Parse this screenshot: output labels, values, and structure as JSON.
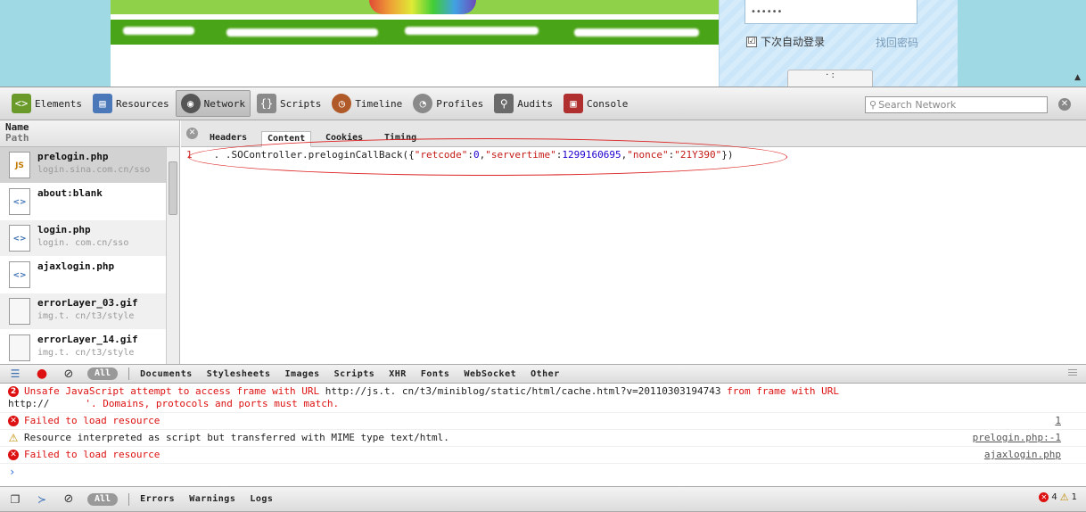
{
  "page": {
    "password_mask": "••••••",
    "remember_label": "下次自动登录",
    "remember_check": "☑",
    "find_password": "找回密码",
    "login_button": "· :",
    "scroll_up": "▲"
  },
  "toolbar": {
    "tools": [
      {
        "label": "Elements",
        "icon": "elements-icon",
        "color": "#6a9b2a"
      },
      {
        "label": "Resources",
        "icon": "resources-icon",
        "color": "#4a78b8"
      },
      {
        "label": "Network",
        "icon": "network-icon",
        "color": "#555555"
      },
      {
        "label": "Scripts",
        "icon": "scripts-icon",
        "color": "#8a8a8a"
      },
      {
        "label": "Timeline",
        "icon": "timeline-icon",
        "color": "#b05a2a"
      },
      {
        "label": "Profiles",
        "icon": "profiles-icon",
        "color": "#8a8a8a"
      },
      {
        "label": "Audits",
        "icon": "audits-icon",
        "color": "#6a6a6a"
      },
      {
        "label": "Console",
        "icon": "console-icon",
        "color": "#b03030"
      }
    ],
    "active": "Network",
    "search_placeholder": "Search Network",
    "close": "✕"
  },
  "resources": {
    "header_name": "Name",
    "header_path": "Path",
    "items": [
      {
        "name": "prelogin.php",
        "path": "login.sina.com.cn/sso",
        "type": "JS"
      },
      {
        "name": "about:blank",
        "path": "",
        "type": "<>"
      },
      {
        "name": "login.php",
        "path": "login.     com.cn/sso",
        "type": "<>"
      },
      {
        "name": "ajaxlogin.php",
        "path": "",
        "type": "<>"
      },
      {
        "name": "errorLayer_03.gif",
        "path": "img.t.      cn/t3/style",
        "type": ""
      },
      {
        "name": "errorLayer_14.gif",
        "path": "img.t.      cn/t3/style",
        "type": ""
      }
    ]
  },
  "detail": {
    "tabs": [
      "Headers",
      "Content",
      "Cookies",
      "Timing"
    ],
    "selected_tab": "Content",
    "close": "✕",
    "line_number": "1",
    "code": {
      "prefix": ". .SOController.preloginCallBack({",
      "k1": "\"retcode\"",
      "v1": "0",
      "k2": "\"servertime\"",
      "v2": "1299160695",
      "k3": "\"nonce\"",
      "v3": "\"21Y390\"",
      "suffix": "})"
    }
  },
  "filters": {
    "all": "All",
    "items": [
      "Documents",
      "Stylesheets",
      "Images",
      "Scripts",
      "XHR",
      "Fonts",
      "WebSocket",
      "Other"
    ]
  },
  "console": {
    "messages": [
      {
        "badge": "2",
        "red1": "Unsafe JavaScript attempt to access frame with URL ",
        "plain1": "http://js.t.       cn/t3/miniblog/static/html/cache.html?v=20110303194743",
        "red2": " from frame with URL",
        "plain2": "http://",
        "red3": "'. Domains, protocols and ports must match.",
        "source": ""
      },
      {
        "badge": "✕",
        "text": "Failed to load resource",
        "source": "1"
      },
      {
        "badge": "⚠",
        "text": "Resource interpreted as script but transferred with MIME type text/html.",
        "source": "prelogin.php:-1"
      },
      {
        "badge": "✕",
        "text": "Failed to load resource",
        "source": "ajaxlogin.php"
      }
    ],
    "prompt": "›"
  },
  "statusbar": {
    "all": "All",
    "filters": [
      "Errors",
      "Warnings",
      "Logs"
    ],
    "error_count": "4",
    "warning_count": "1"
  }
}
